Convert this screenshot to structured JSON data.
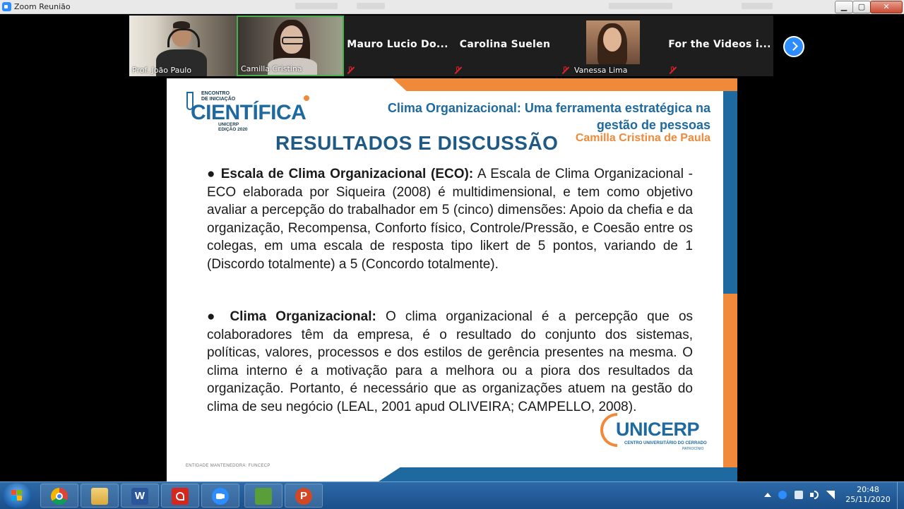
{
  "window": {
    "title": "Zoom Reunião",
    "minimize_label": "▁",
    "maximize_label": "▢",
    "close_label": "✕"
  },
  "participants": [
    {
      "name": "Prof. João Paulo",
      "has_video": true,
      "muted": false
    },
    {
      "name": "Camilla Cristina",
      "has_video": true,
      "muted": false,
      "active_speaker": true
    },
    {
      "name": "Mauro Lucio Do...",
      "has_video": false,
      "muted": true
    },
    {
      "name": "Carolina Suelen",
      "has_video": false,
      "muted": true
    },
    {
      "name": "Vanessa Lima",
      "has_video": false,
      "has_avatar": true,
      "muted": true
    },
    {
      "name": "For the Videos i...",
      "has_video": false,
      "muted": true
    }
  ],
  "slide": {
    "logo": {
      "line1": "ENCONTRO",
      "line2": "DE INICIAÇÃO",
      "big": "CIENTÍFICA",
      "sub1": "UNICERP",
      "sub2": "EDIÇÃO 2020"
    },
    "title": "Clima Organizacional: Uma ferramenta estratégica na gestão de pessoas",
    "author": "Camilla Cristina de Paula",
    "section_title": "RESULTADOS E DISCUSSÃO",
    "paragraphs": [
      {
        "bullet": "●",
        "heading": "Escala de Clima Organizacional (ECO):",
        "text": "A Escala de Clima Organizacional - ECO elaborada por Siqueira (2008) é multidimensional, e tem como objetivo avaliar a percepção do trabalhador em 5 (cinco) dimensões: Apoio da chefia e da organização, Recompensa, Conforto físico, Controle/Pressão, e Coesão entre os colegas, em uma escala de resposta tipo likert de 5 pontos, variando de 1 (Discordo totalmente) a 5 (Concordo totalmente)."
      },
      {
        "bullet": "●",
        "heading": "Clima Organizacional:",
        "text": "O clima organizacional é a percepção que os colaboradores têm da empresa, é o resultado do conjunto dos sistemas, políticas, valores, processos e dos estilos de gerência presentes na mesma. O clima interno é a motivação para a melhora ou a piora dos resultados da organização. Portanto, é necessário que as organizações atuem na gestão do clima de seu negócio (LEAL, 2001 apud OLIVEIRA; CAMPELLO, 2008)."
      }
    ],
    "unicerp_logo": {
      "word": "UNICERP",
      "tagline": "CENTRO UNIVERSITÁRIO DO CERRADO",
      "city": "PATROCÍNIO"
    },
    "footer": "ENTIDADE MANTENEDORA: FUNCECP",
    "colors": {
      "blue": "#1e6aa0",
      "orange": "#f0893a"
    }
  },
  "taskbar": {
    "apps": [
      "chrome-icon",
      "explorer-icon",
      "word-icon",
      "acrobat-icon",
      "zoom-icon",
      "android-icon",
      "powerpoint-icon"
    ],
    "word_glyph": "W",
    "ppt_glyph": "P",
    "time": "20:48",
    "date": "25/11/2020"
  }
}
